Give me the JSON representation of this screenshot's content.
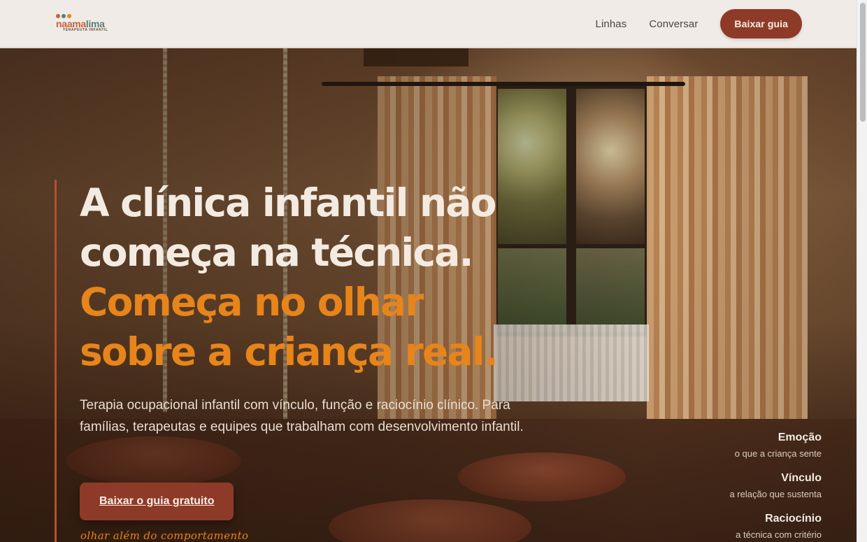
{
  "header": {
    "logo": {
      "name": "naama lima",
      "name_part1": "naama",
      "name_part2": "lima",
      "subtitle": "TERAPEUTA INFANTIL",
      "dot_colors": [
        "#c6623d",
        "#5b7f7a",
        "#e7841a"
      ]
    },
    "nav": [
      {
        "label": "Linhas"
      },
      {
        "label": "Conversar"
      }
    ],
    "cta_label": "Baixar guia"
  },
  "hero": {
    "headline_light_1": "A clínica infantil não",
    "headline_light_2": "começa na técnica.",
    "headline_accent_1": "Começa no olhar",
    "headline_accent_2": "sobre a criança real.",
    "subtitle": "Terapia ocupacional infantil com vínculo, função e raciocínio clínico. Para famílias, terapeutas e equipes que trabalham com desenvolvimento infantil.",
    "cta_label": "Baixar o guia gratuito",
    "tagline": "olhar além do comportamento",
    "pillars": [
      {
        "title": "Emoção",
        "desc": "o que a criança sente"
      },
      {
        "title": "Vínculo",
        "desc": "a relação que sustenta"
      },
      {
        "title": "Raciocínio",
        "desc": "a técnica com critério"
      }
    ]
  },
  "colors": {
    "brand": "#8e3a28",
    "accent": "#e7841a",
    "header_bg": "#f0ebe6"
  }
}
